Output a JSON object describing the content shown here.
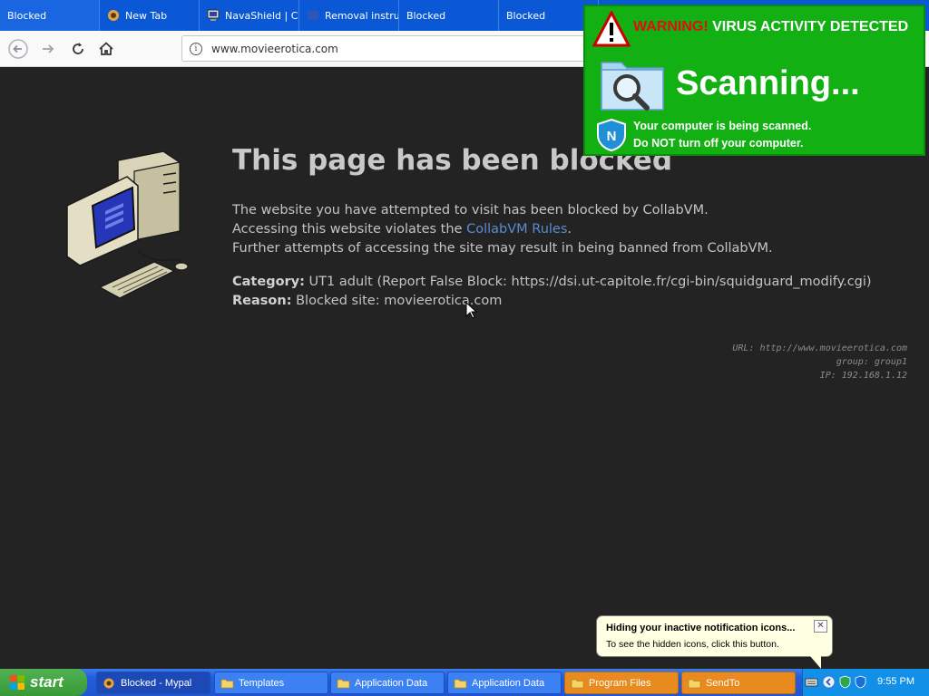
{
  "browser": {
    "tabs": [
      {
        "label": "Blocked",
        "icon": "none"
      },
      {
        "label": "New Tab",
        "icon": "browser-icon"
      },
      {
        "label": "NavaShield | C",
        "icon": "computer-icon"
      },
      {
        "label": "Removal instru",
        "icon": "page-icon"
      },
      {
        "label": "Blocked",
        "icon": "none"
      },
      {
        "label": "Blocked",
        "icon": "none"
      }
    ],
    "url": "www.movieerotica.com"
  },
  "blocked_page": {
    "title": "This page has been blocked",
    "line1": "The website you have attempted to visit has been blocked by CollabVM.",
    "line2_prefix": "Accessing this website violates the ",
    "line2_link": "CollabVM Rules",
    "line2_suffix": ".",
    "line3": "Further attempts of accessing the site may result in being banned from CollabVM.",
    "category_label": "Category:",
    "category_value": "UT1 adult (Report False Block: https://dsi.ut-capitole.fr/cgi-bin/squidguard_modify.cgi)",
    "reason_label": "Reason:",
    "reason_value": "Blocked site: movieerotica.com",
    "tech_url": "URL: http://www.movieerotica.com",
    "tech_group": "group: group1",
    "tech_ip": "IP: 192.168.1.12"
  },
  "popup": {
    "warning_word": "WARNING!",
    "warning_rest": "VIRUS ACTIVITY DETECTED",
    "scanning": "Scanning...",
    "msg1": "Your computer is being scanned.",
    "msg2_pre": "Do ",
    "msg2_bold": "NOT",
    "msg2_post": " turn off your computer."
  },
  "balloon": {
    "title": "Hiding your inactive notification icons...",
    "text": "To see the hidden icons, click this button.",
    "close": "✕"
  },
  "taskbar": {
    "start": "start",
    "tasks": [
      {
        "label": "Blocked - Mypal",
        "style": "active"
      },
      {
        "label": "Templates",
        "style": "normal"
      },
      {
        "label": "Application Data",
        "style": "normal"
      },
      {
        "label": "Application Data",
        "style": "normal"
      },
      {
        "label": "Program Files",
        "style": "orange"
      },
      {
        "label": "SendTo",
        "style": "orange"
      }
    ],
    "clock": "9:55 PM"
  },
  "colors": {
    "page_bg": "#232323",
    "tabbar": "#0a58d6",
    "popup_green": "#12b012",
    "link": "#5b8bd0"
  }
}
